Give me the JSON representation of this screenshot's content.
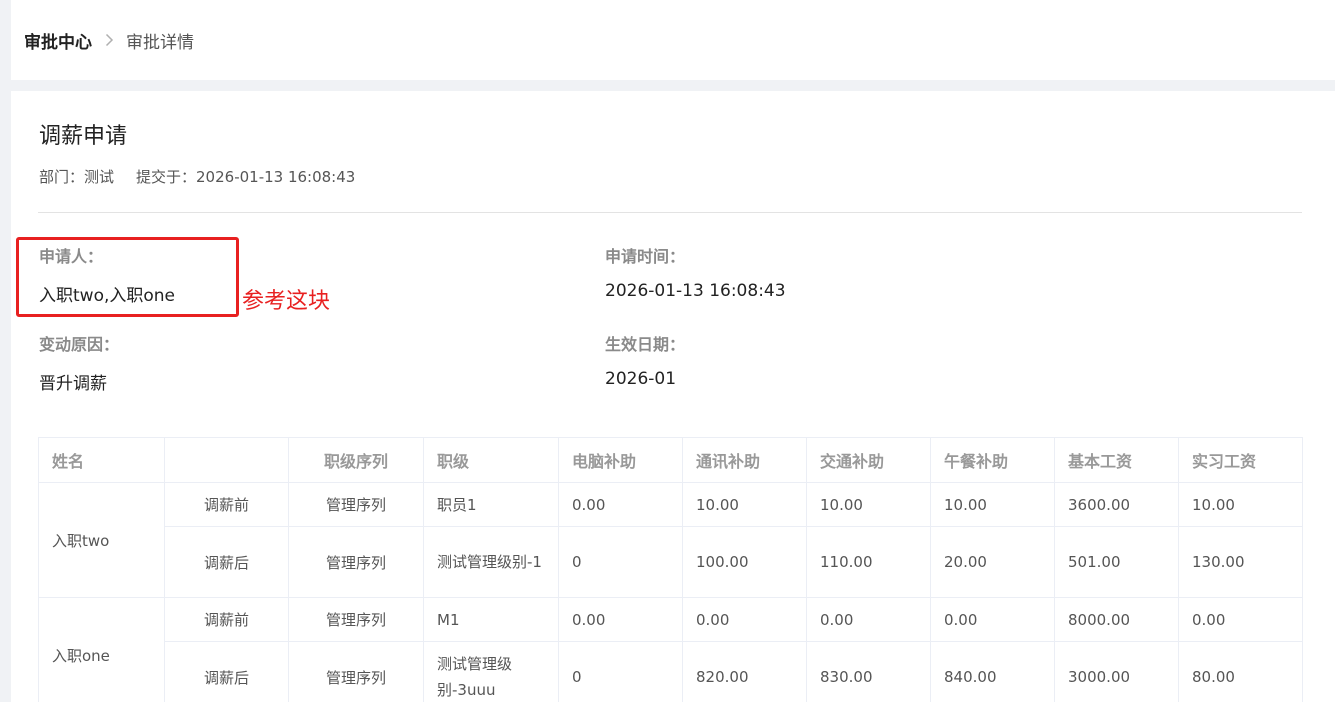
{
  "breadcrumb": {
    "root": "审批中心",
    "current": "审批详情"
  },
  "page": {
    "title": "调薪申请",
    "meta_department": "部门：测试",
    "meta_submitted": "提交于：2026-01-13 16:08:43"
  },
  "fields": {
    "applicant_label": "申请人：",
    "applicant_value": "入职two,入职one",
    "apply_time_label": "申请时间：",
    "apply_time_value": "2026-01-13 16:08:43",
    "reason_label": "变动原因：",
    "reason_value": "晋升调薪",
    "effective_label": "生效日期：",
    "effective_value": "2026-01"
  },
  "annotation": {
    "text": "参考这块",
    "color": "#e82020"
  },
  "table": {
    "headers": [
      "姓名",
      "",
      "职级序列",
      "职级",
      "电脑补助",
      "通讯补助",
      "交通补助",
      "午餐补助",
      "基本工资",
      "实习工资"
    ],
    "groups": [
      {
        "name": "入职two",
        "rows": [
          {
            "stage": "调薪前",
            "seq": "管理序列",
            "level": "职员1",
            "computer": "0.00",
            "comm": "10.00",
            "traffic": "10.00",
            "lunch": "10.00",
            "base": "3600.00",
            "intern": "10.00"
          },
          {
            "stage": "调薪后",
            "seq": "管理序列",
            "level": "测试管理级别-1",
            "computer": "0",
            "comm": "100.00",
            "traffic": "110.00",
            "lunch": "20.00",
            "base": "501.00",
            "intern": "130.00"
          }
        ]
      },
      {
        "name": "入职one",
        "rows": [
          {
            "stage": "调薪前",
            "seq": "管理序列",
            "level": "M1",
            "computer": "0.00",
            "comm": "0.00",
            "traffic": "0.00",
            "lunch": "0.00",
            "base": "8000.00",
            "intern": "0.00"
          },
          {
            "stage": "调薪后",
            "seq": "管理序列",
            "level": "测试管理级别-3uuu",
            "computer": "0",
            "comm": "820.00",
            "traffic": "830.00",
            "lunch": "840.00",
            "base": "3000.00",
            "intern": "80.00"
          }
        ]
      }
    ]
  },
  "colors": {
    "accent_red": "#e82020",
    "page_bg": "#f0f2f5",
    "border": "#ebeef5"
  }
}
